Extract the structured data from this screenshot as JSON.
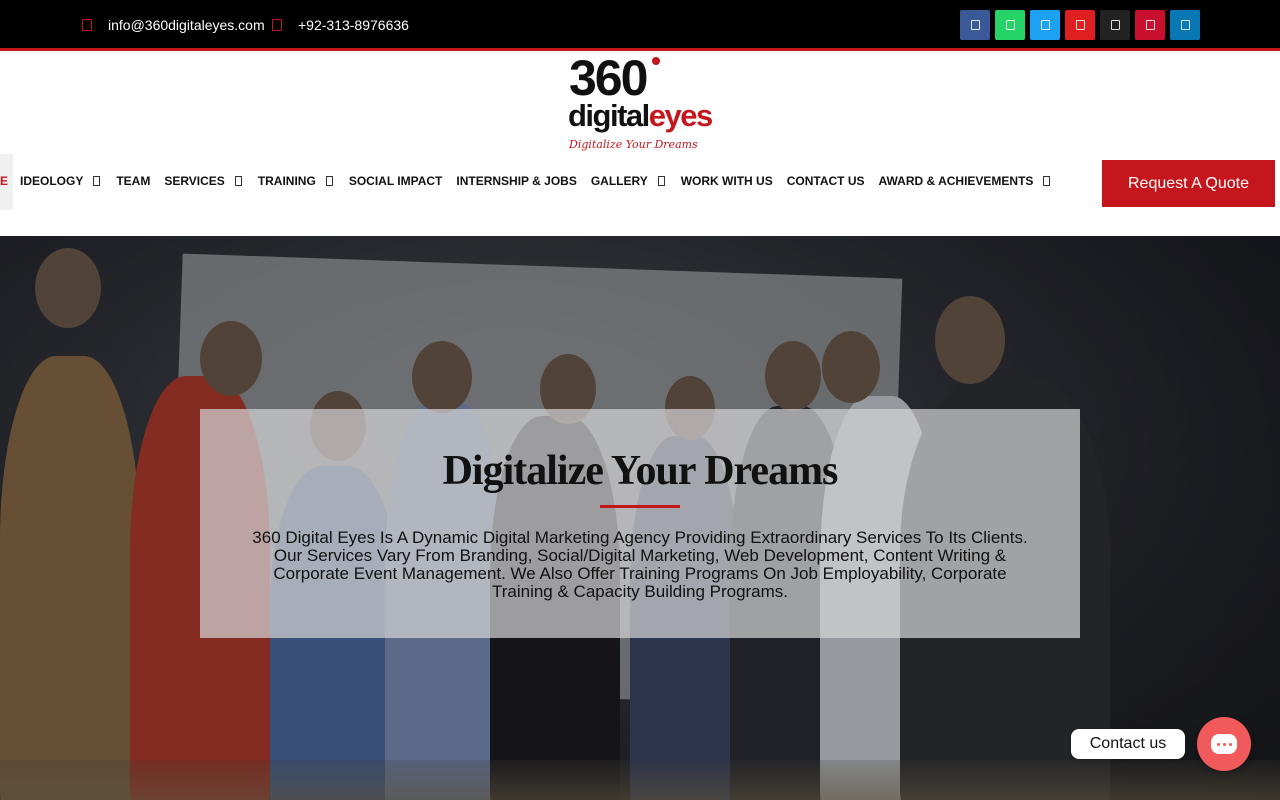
{
  "topbar": {
    "email": "info@360digitaleyes.com",
    "phone": "+92-313-8976636",
    "social": [
      {
        "icon": "facebook-icon",
        "color": "#3b5998"
      },
      {
        "icon": "whatsapp-icon",
        "color": "#25d366"
      },
      {
        "icon": "twitter-icon",
        "color": "#1da1f2"
      },
      {
        "icon": "youtube-icon",
        "color": "#e02020"
      },
      {
        "icon": "tiktok-icon",
        "color": "#222222"
      },
      {
        "icon": "pinterest-icon",
        "color": "#c8102e"
      },
      {
        "icon": "linkedin-icon",
        "color": "#0a77b5"
      }
    ]
  },
  "logo": {
    "number": "360",
    "word_dark": "digital",
    "word_red": "eyes",
    "tagline": "Digitalize Your Dreams"
  },
  "nav": {
    "partial_item": "E",
    "items": [
      {
        "label": "IDEOLOGY",
        "has_dropdown": true
      },
      {
        "label": "TEAM",
        "has_dropdown": false
      },
      {
        "label": "SERVICES",
        "has_dropdown": true
      },
      {
        "label": "TRAINING",
        "has_dropdown": true
      },
      {
        "label": "SOCIAL IMPACT",
        "has_dropdown": false
      },
      {
        "label": "INTERNSHIP & JOBS",
        "has_dropdown": false
      },
      {
        "label": "GALLERY",
        "has_dropdown": true
      },
      {
        "label": "WORK WITH US",
        "has_dropdown": false
      },
      {
        "label": "CONTACT US",
        "has_dropdown": false
      },
      {
        "label": "AWARD & ACHIEVEMENTS",
        "has_dropdown": true
      }
    ],
    "cta": "Request A Quote"
  },
  "hero": {
    "title": "Digitalize Your Dreams",
    "description": "360 Digital Eyes Is A Dynamic Digital Marketing Agency Providing Extraordinary Services To Its Clients. Our Services Vary From Branding, Social/Digital Marketing, Web Development, Content Writing & Corporate Event Management. We Also Offer Training Programs On Job Employability, Corporate Training & Capacity Building Programs."
  },
  "widget": {
    "label": "Contact us"
  },
  "colors": {
    "brand_red": "#c4161c",
    "topbar": "#000000",
    "fab": "#f05a5a"
  }
}
